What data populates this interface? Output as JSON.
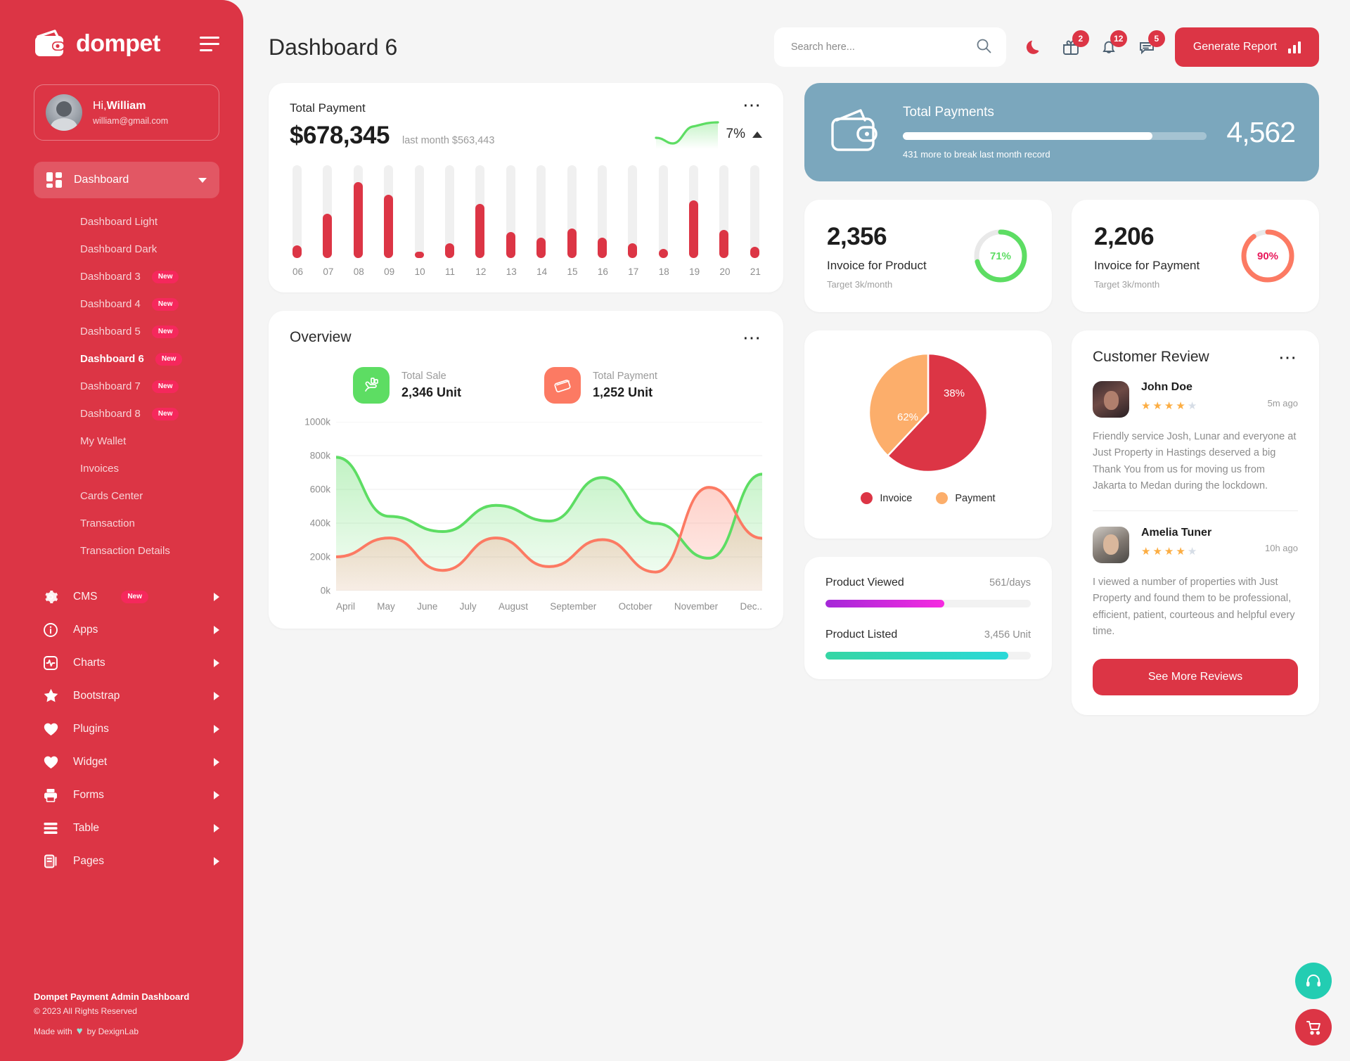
{
  "sidebar": {
    "brand": "dompet",
    "brand_logo_icon": "wallet-icon",
    "menu_toggle_icon": "hamburger-icon",
    "profile": {
      "greeting_prefix": "Hi,",
      "name": "William",
      "email": "william@gmail.com",
      "avatar_icon": "user-avatar"
    },
    "active_group": {
      "label": "Dashboard",
      "icon": "grid-icon",
      "caret": "chevron-down-icon"
    },
    "submenu": [
      {
        "label": "Dashboard Light",
        "badge": "",
        "active": false
      },
      {
        "label": "Dashboard Dark",
        "badge": "",
        "active": false
      },
      {
        "label": "Dashboard 3",
        "badge": "New",
        "active": false
      },
      {
        "label": "Dashboard 4",
        "badge": "New",
        "active": false
      },
      {
        "label": "Dashboard 5",
        "badge": "New",
        "active": false
      },
      {
        "label": "Dashboard 6",
        "badge": "New",
        "active": true
      },
      {
        "label": "Dashboard 7",
        "badge": "New",
        "active": false
      },
      {
        "label": "Dashboard 8",
        "badge": "New",
        "active": false
      },
      {
        "label": "My Wallet",
        "badge": "",
        "active": false
      },
      {
        "label": "Invoices",
        "badge": "",
        "active": false
      },
      {
        "label": "Cards Center",
        "badge": "",
        "active": false
      },
      {
        "label": "Transaction",
        "badge": "",
        "active": false
      },
      {
        "label": "Transaction Details",
        "badge": "",
        "active": false
      }
    ],
    "main_menu": [
      {
        "label": "CMS",
        "icon": "gear-icon",
        "badge": "New"
      },
      {
        "label": "Apps",
        "icon": "info-icon",
        "badge": ""
      },
      {
        "label": "Charts",
        "icon": "pulse-icon",
        "badge": ""
      },
      {
        "label": "Bootstrap",
        "icon": "star-icon",
        "badge": ""
      },
      {
        "label": "Plugins",
        "icon": "heart-icon",
        "badge": ""
      },
      {
        "label": "Widget",
        "icon": "heart-icon",
        "badge": ""
      },
      {
        "label": "Forms",
        "icon": "printer-icon",
        "badge": ""
      },
      {
        "label": "Table",
        "icon": "table-icon",
        "badge": ""
      },
      {
        "label": "Pages",
        "icon": "pages-icon",
        "badge": ""
      }
    ],
    "footer": {
      "title": "Dompet Payment Admin Dashboard",
      "copyright": "© 2023 All Rights Reserved",
      "made_prefix": "Made with",
      "made_suffix": "by DexignLab",
      "heart_icon": "heart-icon"
    }
  },
  "header": {
    "title": "Dashboard 6",
    "search": {
      "placeholder": "Search here...",
      "value": "",
      "icon": "search-icon"
    },
    "icons": [
      {
        "name": "moon-icon",
        "badge": ""
      },
      {
        "name": "gift-icon",
        "badge": "2"
      },
      {
        "name": "bell-icon",
        "badge": "12"
      },
      {
        "name": "message-icon",
        "badge": "5"
      }
    ],
    "generate_button": {
      "label": "Generate Report",
      "icon": "bar-chart-icon"
    }
  },
  "total_payment": {
    "label": "Total Payment",
    "amount": "$678,345",
    "last_month": "last month $563,443",
    "trend_pct": "7%",
    "trend_icon": "triangle-up-icon",
    "menu_icon": "more-dots-icon"
  },
  "total_payments_banner": {
    "title": "Total Payments",
    "value": "4,562",
    "subtitle": "431 more to break last month record",
    "progress_pct": 82,
    "icon": "wallet-icon",
    "bg_color": "#7ba7bd"
  },
  "gauges": [
    {
      "value": "2,356",
      "label": "Invoice for Product",
      "target": "Target 3k/month",
      "pct": 71,
      "pct_label": "71%",
      "color": "#5ddd63"
    },
    {
      "value": "2,206",
      "label": "Invoice for Payment",
      "target": "Target 3k/month",
      "pct": 90,
      "pct_label": "90%",
      "color": "#fc7a63"
    }
  ],
  "overview": {
    "title": "Overview",
    "menu_icon": "more-dots-icon",
    "stats": [
      {
        "label": "Total Sale",
        "value": "2,346 Unit",
        "icon": "sale-hand-icon",
        "color": "#5ddd63"
      },
      {
        "label": "Total Payment",
        "value": "1,252 Unit",
        "icon": "card-swipe-icon",
        "color": "#fc7a63"
      }
    ]
  },
  "product_progress": [
    {
      "label": "Product Viewed",
      "value": "561/days",
      "pct": 58,
      "color_from": "#a428d8",
      "color_to": "#f62ae0"
    },
    {
      "label": "Product Listed",
      "value": "3,456 Unit",
      "pct": 89,
      "color_from": "#35d6a4",
      "color_to": "#2ad8d8"
    }
  ],
  "customer_review": {
    "title": "Customer Review",
    "menu_icon": "more-dots-icon",
    "button_label": "See More Reviews",
    "reviews": [
      {
        "name": "John Doe",
        "stars": 4,
        "max_stars": 5,
        "time": "5m ago",
        "text": "Friendly service Josh, Lunar and everyone at Just Property in Hastings deserved a big Thank You from us for moving us from Jakarta to Medan during the lockdown.",
        "avatar_icon": "reviewer-avatar"
      },
      {
        "name": "Amelia Tuner",
        "stars": 4,
        "max_stars": 5,
        "time": "10h ago",
        "text": "I viewed a number of properties with Just Property and found them to be professional, efficient, patient, courteous and helpful every time.",
        "avatar_icon": "reviewer-avatar"
      }
    ]
  },
  "floating_buttons": [
    {
      "name": "support-headset-icon",
      "color": "#23cdb2"
    },
    {
      "name": "shopping-cart-icon",
      "color": "#dc3545"
    }
  ],
  "chart_data": [
    {
      "type": "bar",
      "title": "Total Payment",
      "categories": [
        "06",
        "07",
        "08",
        "09",
        "10",
        "11",
        "12",
        "13",
        "14",
        "15",
        "16",
        "17",
        "18",
        "19",
        "20",
        "21"
      ],
      "values": [
        14,
        48,
        82,
        68,
        7,
        16,
        58,
        28,
        22,
        32,
        22,
        16,
        10,
        62,
        30,
        12
      ],
      "track_max": 100,
      "xlabel": "",
      "ylabel": "",
      "ylim": [
        0,
        100
      ],
      "grid": false,
      "legend": false,
      "bar_color": "#dc3545",
      "track_color": "#f0f0f0"
    },
    {
      "type": "area",
      "title": "Overview",
      "x": [
        "April",
        "May",
        "June",
        "July",
        "August",
        "September",
        "October",
        "November",
        "Dec.."
      ],
      "ylim": [
        0,
        1000000
      ],
      "yticks": [
        "0k",
        "200k",
        "400k",
        "600k",
        "800k",
        "1000k"
      ],
      "ytick_values": [
        0,
        200000,
        400000,
        600000,
        800000,
        1000000
      ],
      "grid": true,
      "legend": false,
      "series": [
        {
          "name": "Total Sale",
          "color": "#5ddd63",
          "values": [
            790000,
            440000,
            350000,
            505000,
            412000,
            670000,
            398000,
            192000,
            690000
          ]
        },
        {
          "name": "Total Payment",
          "color": "#fc7a63",
          "values": [
            200000,
            312000,
            120000,
            312000,
            142000,
            302000,
            110000,
            612000,
            310000
          ]
        }
      ]
    },
    {
      "type": "pie",
      "title": "",
      "labels": [
        "Invoice",
        "Payment"
      ],
      "values": [
        62,
        38
      ],
      "value_labels": [
        "62%",
        "38%"
      ],
      "colors": [
        "#dc3545",
        "#fcae6b"
      ],
      "legend": "bottom"
    }
  ]
}
